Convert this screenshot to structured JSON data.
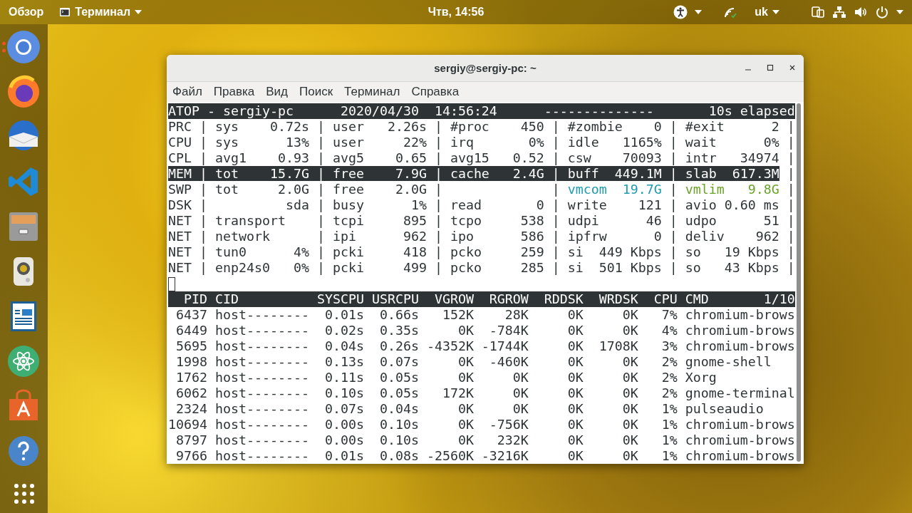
{
  "top_bar": {
    "activities": "Обзор",
    "app_menu": "Терминал",
    "clock": "Чтв, 14:56",
    "keyboard_layout": "uk"
  },
  "dock": {
    "items": [
      {
        "running": true
      },
      {
        "running": false
      },
      {
        "running": false
      },
      {
        "running": false
      },
      {
        "running": false
      },
      {
        "running": false
      },
      {
        "running": false
      },
      {
        "running": false
      },
      {
        "running": false
      },
      {
        "running": false
      }
    ]
  },
  "window": {
    "title": "sergiy@sergiy-pc: ~",
    "menu": [
      "Файл",
      "Правка",
      "Вид",
      "Поиск",
      "Терминал",
      "Справка"
    ],
    "terminal": {
      "lines": [
        {
          "kind": "text",
          "inverse": true,
          "text": "ATOP - sergiy-pc      2020/04/30  14:56:24      --------------       10s elapsed"
        },
        {
          "kind": "text",
          "inverse": false,
          "text": "PRC | sys    0.72s | user   2.26s | #proc    450 | #zombie    0 | #exit      2 |"
        },
        {
          "kind": "text",
          "inverse": false,
          "text": "CPU | sys      13% | user     22% | irq       0% | idle   1165% | wait      0% |"
        },
        {
          "kind": "text",
          "inverse": false,
          "text": "CPL | avg1    0.93 | avg5    0.65 | avg15   0.52 | csw    70093 | intr   34974 |"
        },
        {
          "kind": "segments",
          "segments": [
            {
              "text": "MEM | tot    15.7G | free    7.9G | cache   2.4G | buff  449.1M | slab  617.3M",
              "inverse": true
            },
            {
              "text": " |",
              "inverse": false
            }
          ]
        },
        {
          "kind": "segments",
          "segments": [
            {
              "text": "SWP | tot     2.0G | free    2.0G |              | "
            },
            {
              "text": "vmcom  19.7G",
              "color": "#1e9bae"
            },
            {
              "text": " | "
            },
            {
              "text": "vmlim   9.8G",
              "color": "#6aa326"
            },
            {
              "text": " |"
            }
          ]
        },
        {
          "kind": "text",
          "inverse": false,
          "text": "DSK |          sda | busy      1% | read       0 | write    121 | avio 0.60 ms |"
        },
        {
          "kind": "text",
          "inverse": false,
          "text": "NET | transport    | tcpi     895 | tcpo     538 | udpi      46 | udpo      51 |"
        },
        {
          "kind": "text",
          "inverse": false,
          "text": "NET | network      | ipi      962 | ipo      586 | ipfrw      0 | deliv    962 |"
        },
        {
          "kind": "text",
          "inverse": false,
          "text": "NET | tun0      4% | pcki     418 | pcko     259 | si  449 Kbps | so   19 Kbps |"
        },
        {
          "kind": "text",
          "inverse": false,
          "text": "NET | enp24s0   0% | pcki     499 | pcko     285 | si  501 Kbps | so   43 Kbps |"
        },
        {
          "kind": "cursor"
        },
        {
          "kind": "text",
          "inverse": true,
          "text": "  PID CID          SYSCPU USRCPU  VGROW  RGROW  RDDSK  WRDSK  CPU CMD       1/10"
        },
        {
          "kind": "text",
          "inverse": false,
          "text": " 6437 host--------  0.01s  0.66s   152K    28K     0K     0K   7% chromium-brows"
        },
        {
          "kind": "text",
          "inverse": false,
          "text": " 6449 host--------  0.02s  0.35s     0K  -784K     0K     0K   4% chromium-brows"
        },
        {
          "kind": "text",
          "inverse": false,
          "text": " 5695 host--------  0.04s  0.26s -4352K -1744K     0K  1708K   3% chromium-brows"
        },
        {
          "kind": "text",
          "inverse": false,
          "text": " 1998 host--------  0.13s  0.07s     0K  -460K     0K     0K   2% gnome-shell"
        },
        {
          "kind": "text",
          "inverse": false,
          "text": " 1762 host--------  0.11s  0.05s     0K     0K     0K     0K   2% Xorg"
        },
        {
          "kind": "text",
          "inverse": false,
          "text": " 6062 host--------  0.10s  0.05s   172K     0K     0K     0K   2% gnome-terminal"
        },
        {
          "kind": "text",
          "inverse": false,
          "text": " 2324 host--------  0.07s  0.04s     0K     0K     0K     0K   1% pulseaudio"
        },
        {
          "kind": "text",
          "inverse": false,
          "text": "10694 host--------  0.00s  0.10s     0K  -756K     0K     0K   1% chromium-brows"
        },
        {
          "kind": "text",
          "inverse": false,
          "text": " 8797 host--------  0.00s  0.10s     0K   232K     0K     0K   1% chromium-brows"
        },
        {
          "kind": "text",
          "inverse": false,
          "text": " 9766 host--------  0.01s  0.08s -2560K -3216K     0K     0K   1% chromium-brows"
        }
      ]
    }
  }
}
